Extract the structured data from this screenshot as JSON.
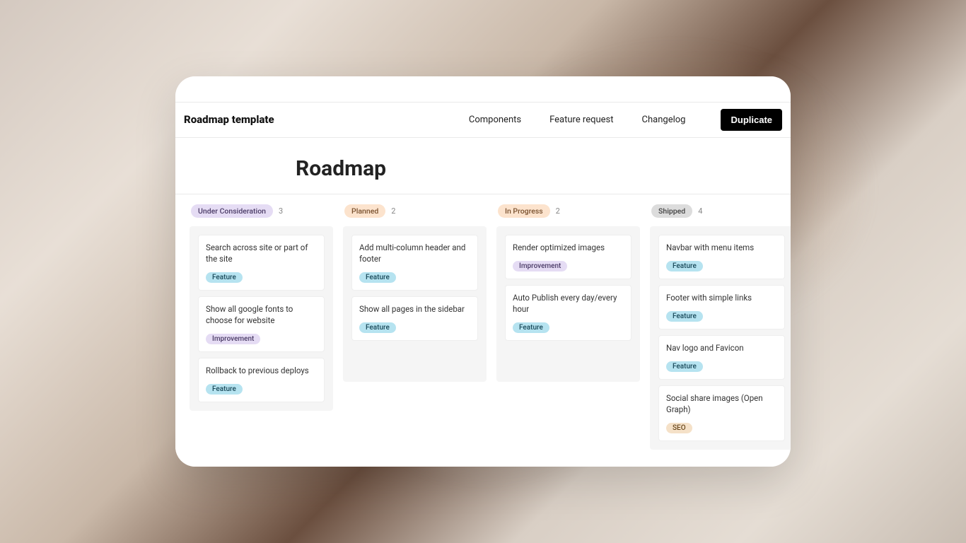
{
  "header": {
    "site_title": "Roadmap template",
    "nav": [
      {
        "label": "Components"
      },
      {
        "label": "Feature request"
      },
      {
        "label": "Changelog"
      }
    ],
    "duplicate_label": "Duplicate"
  },
  "page": {
    "title": "Roadmap"
  },
  "columns": [
    {
      "status": "Under Consideration",
      "pill_class": "pill-consideration",
      "count": "3",
      "cards": [
        {
          "title": "Search across site or part of the site",
          "tag": "Feature",
          "tag_class": "tag-feature"
        },
        {
          "title": "Show all google fonts to choose for website",
          "tag": "Improvement",
          "tag_class": "tag-improvement"
        },
        {
          "title": "Rollback to previous deploys",
          "tag": "Feature",
          "tag_class": "tag-feature"
        }
      ]
    },
    {
      "status": "Planned",
      "pill_class": "pill-planned",
      "count": "2",
      "cards": [
        {
          "title": "Add multi-column header and footer",
          "tag": "Feature",
          "tag_class": "tag-feature"
        },
        {
          "title": "Show all pages in the sidebar",
          "tag": "Feature",
          "tag_class": "tag-feature"
        }
      ]
    },
    {
      "status": "In Progress",
      "pill_class": "pill-inprogress",
      "count": "2",
      "cards": [
        {
          "title": "Render optimized images",
          "tag": "Improvement",
          "tag_class": "tag-improvement"
        },
        {
          "title": "Auto Publish every day/every hour",
          "tag": "Feature",
          "tag_class": "tag-feature"
        }
      ]
    },
    {
      "status": "Shipped",
      "pill_class": "pill-shipped",
      "count": "4",
      "cards": [
        {
          "title": "Navbar with menu items",
          "tag": "Feature",
          "tag_class": "tag-feature"
        },
        {
          "title": "Footer with simple links",
          "tag": "Feature",
          "tag_class": "tag-feature"
        },
        {
          "title": "Nav logo and Favicon",
          "tag": "Feature",
          "tag_class": "tag-feature"
        },
        {
          "title": "Social share images (Open Graph)",
          "tag": "SEO",
          "tag_class": "tag-seo"
        }
      ]
    }
  ]
}
